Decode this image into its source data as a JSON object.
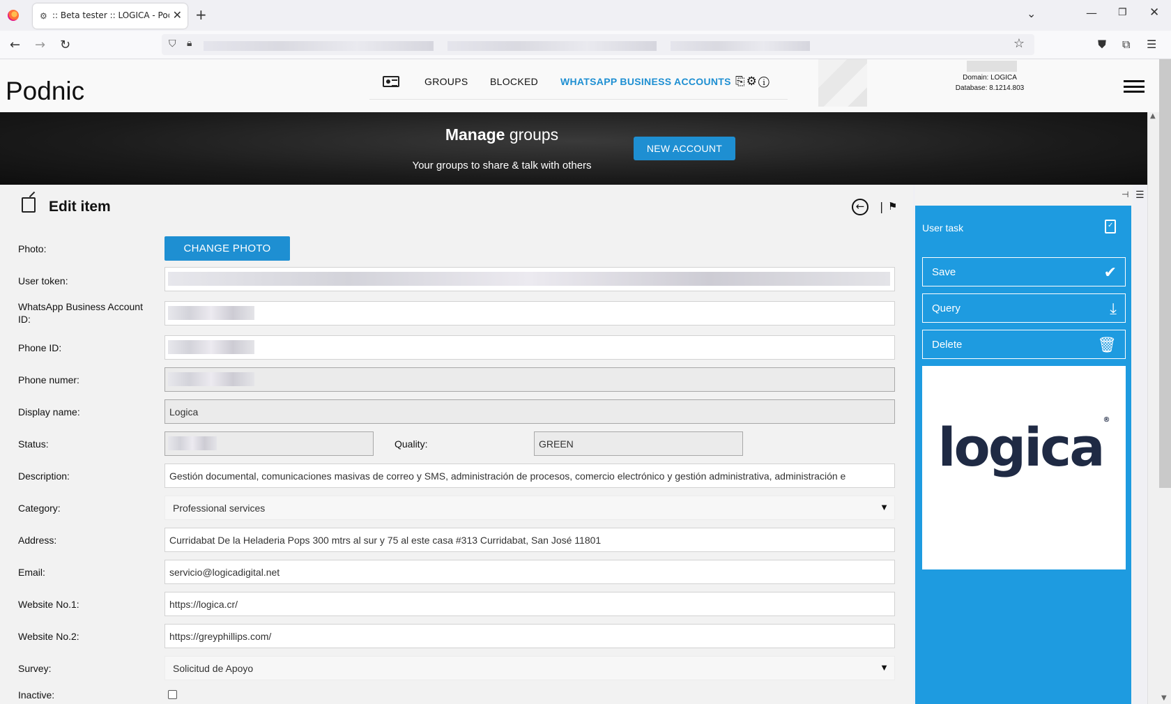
{
  "browser": {
    "tab_title": ":: Beta tester :: LOGICA - Podnic",
    "tab_close": "✕",
    "new_tab": "+",
    "back": "←",
    "forward": "→",
    "reload": "↻"
  },
  "header": {
    "brand": "Podnic",
    "menu": {
      "groups": "GROUPS",
      "blocked": "BLOCKED",
      "whatsapp": "WHATSAPP BUSINESS ACCOUNTS"
    },
    "domain": "Domain: LOGICA",
    "database": "Database: 8.1214.803"
  },
  "banner": {
    "title_bold": "Manage",
    "title_rest": " groups",
    "subtitle": "Your groups to share & talk with others",
    "new_account": "NEW ACCOUNT"
  },
  "form": {
    "title": "Edit item",
    "change_photo": "CHANGE PHOTO",
    "labels": {
      "photo": "Photo:",
      "user_token": "User token:",
      "waba_id": "WhatsApp Business Account ID:",
      "phone_id": "Phone ID:",
      "phone_number": "Phone numer:",
      "display_name": "Display name:",
      "status": "Status:",
      "quality": "Quality:",
      "description": "Description:",
      "category": "Category:",
      "address": "Address:",
      "email": "Email:",
      "website1": "Website No.1:",
      "website2": "Website No.2:",
      "survey": "Survey:",
      "inactive": "Inactive:"
    },
    "values": {
      "display_name": "Logica",
      "quality": "GREEN",
      "description": "Gestión documental, comunicaciones masivas de correo y SMS, administración de procesos, comercio electrónico y gestión administrativa, administración e",
      "category": "Professional services",
      "address": "Curridabat De la Heladeria Pops 300 mtrs al sur y 75 al este casa #313 Curridabat, San José 11801",
      "email": "servicio@logicadigital.net",
      "website1": "https://logica.cr/",
      "website2": "https://greyphillips.com/",
      "survey": "Solicitud de Apoyo"
    }
  },
  "sidepanel": {
    "task_title": "User task",
    "save": "Save",
    "query": "Query",
    "delete": "Delete",
    "logo_text": "logica",
    "logo_reg": "®"
  },
  "colors": {
    "accent": "#1e8fd2",
    "panel": "#1e9be0",
    "logo": "#1f2a44"
  }
}
